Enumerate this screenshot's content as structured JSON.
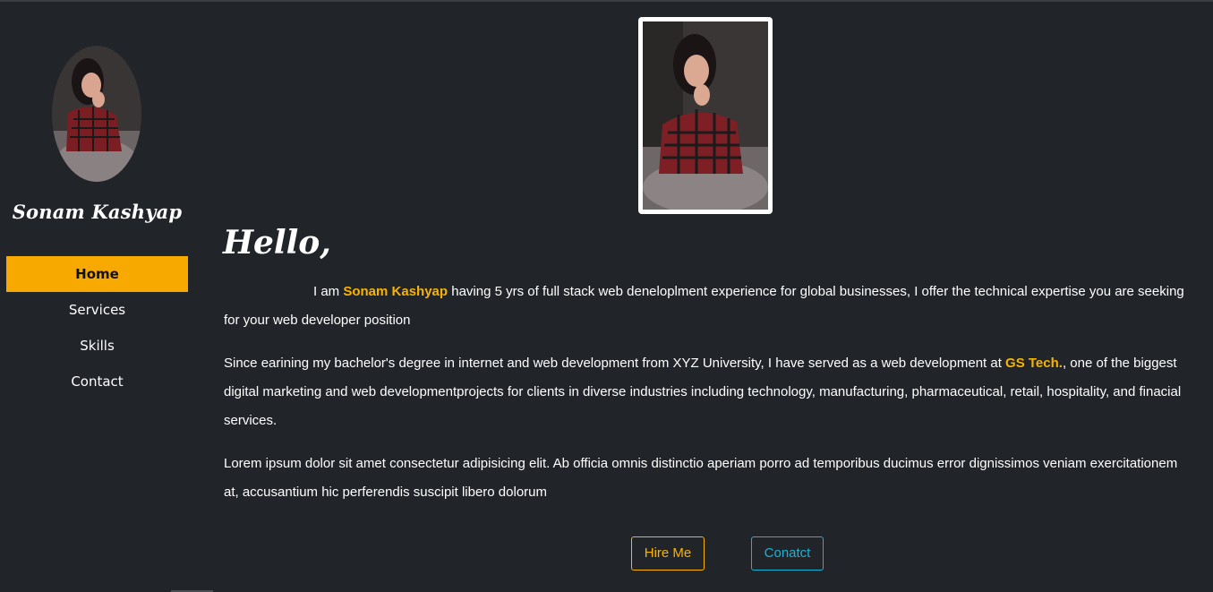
{
  "sidebar": {
    "name": "Sonam Kashyap",
    "nav": [
      {
        "label": "Home",
        "active": true
      },
      {
        "label": "Services",
        "active": false
      },
      {
        "label": "Skills",
        "active": false
      },
      {
        "label": "Contact",
        "active": false
      }
    ]
  },
  "main": {
    "greeting": "Hello,",
    "p1": {
      "before": "I am ",
      "name": "Sonam Kashyap",
      "after": " having 5 yrs of full stack web deneloplment experience for global businesses, I offer the technical expertise you are seeking for your web developer position"
    },
    "p2": {
      "before": "Since earining my bachelor's degree in internet and web development from XYZ University, I have served as a web development at ",
      "company": "GS Tech.",
      "after": ", one of the biggest digital marketing and web developmentprojects for clients in diverse industries including technology, manufacturing, pharmaceutical, retail, hospitality, and finacial services."
    },
    "p3": "Lorem ipsum dolor sit amet consectetur adipisicing elit. Ab officia omnis distinctio aperiam porro ad temporibus ducimus error dignissimos veniam exercitationem at, accusantium hic perferendis suscipit libero dolorum",
    "buttons": {
      "hire": "Hire Me",
      "contact": "Conatct"
    }
  },
  "colors": {
    "background": "#212429",
    "accent": "#f8b400",
    "nav_active": "#f8a900",
    "contact": "#19b3d6"
  }
}
